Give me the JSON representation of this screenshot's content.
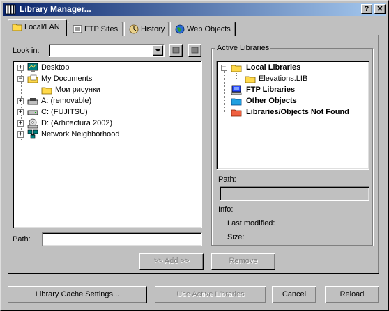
{
  "window": {
    "title": "Library Manager...",
    "help_glyph": "?",
    "close_glyph": "✕"
  },
  "tabs": [
    {
      "label": "Local/LAN",
      "icon": "folder-icon"
    },
    {
      "label": "FTP Sites",
      "icon": "ftp-icon"
    },
    {
      "label": "History",
      "icon": "history-icon"
    },
    {
      "label": "Web Objects",
      "icon": "globe-icon"
    }
  ],
  "browser": {
    "look_in_label": "Look in:",
    "look_in_value": "",
    "tree": [
      {
        "label": "Desktop",
        "icon": "desktop-icon",
        "expander": "+"
      },
      {
        "label": "My Documents",
        "icon": "my-documents-icon",
        "expander": "−"
      },
      {
        "label": "Мои рисунки",
        "icon": "folder-icon",
        "expander": ""
      },
      {
        "label": "A: (removable)",
        "icon": "floppy-drive-icon",
        "expander": "+"
      },
      {
        "label": "C: (FUJITSU)",
        "icon": "hard-drive-icon",
        "expander": "+"
      },
      {
        "label": "D: (Arhitectura 2002)",
        "icon": "cd-drive-icon",
        "expander": "+"
      },
      {
        "label": "Network Neighborhood",
        "icon": "network-icon",
        "expander": "+"
      }
    ],
    "path_label": "Path:",
    "path_value": ""
  },
  "active_libraries": {
    "group_title": "Active Libraries",
    "tree": [
      {
        "label": "Local Libraries",
        "icon": "folder-icon",
        "expander": "−",
        "bold": true
      },
      {
        "label": "Elevations.LIB",
        "icon": "folder-icon",
        "expander": "",
        "bold": false
      },
      {
        "label": "FTP Libraries",
        "icon": "ftp-library-icon",
        "expander": "",
        "bold": true
      },
      {
        "label": "Other Objects",
        "icon": "other-objects-icon",
        "expander": "",
        "bold": true
      },
      {
        "label": "Libraries/Objects Not Found",
        "icon": "not-found-icon",
        "expander": "",
        "bold": true
      }
    ],
    "path_label": "Path:",
    "path_value": "",
    "info_label": "Info:",
    "last_modified_label": "Last modified:",
    "size_label": "Size:"
  },
  "buttons": {
    "add": ">> Add >>",
    "remove": "Remove",
    "cache_settings": "Library Cache Settings...",
    "use_active": "Use Active Libraries",
    "cancel": "Cancel",
    "reload": "Reload"
  }
}
